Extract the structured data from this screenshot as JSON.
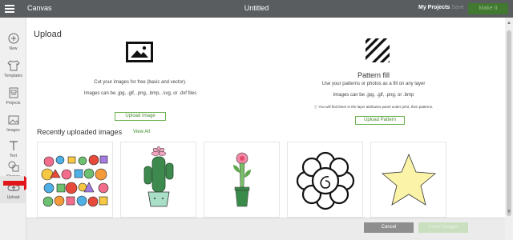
{
  "topbar": {
    "app_name": "Canvas",
    "document_title": "Untitled",
    "my_projects": "My Projects",
    "save": "Save",
    "make_it": "Make It"
  },
  "sidebar": {
    "items": [
      {
        "label": "New",
        "icon": "plus-icon"
      },
      {
        "label": "Templates",
        "icon": "shirt-icon"
      },
      {
        "label": "Projects",
        "icon": "projects-icon"
      },
      {
        "label": "Images",
        "icon": "image-icon"
      },
      {
        "label": "Text",
        "icon": "text-icon"
      },
      {
        "label": "Shapes",
        "icon": "shapes-icon"
      },
      {
        "label": "Upload",
        "icon": "upload-icon"
      }
    ]
  },
  "upload": {
    "title": "Upload",
    "description_1": "Cut your images for free (basic and vector).",
    "description_2": "Images can be .jpg, .gif, .png, .bmp, .svg, or .dxf files",
    "button": "Upload Image"
  },
  "pattern": {
    "title": "Pattern fill",
    "description_1": "Use your patterns or photos as a fill on any layer",
    "description_2": "Images can be .jpg, .gif, .png, or .bmp",
    "info": "You will find them in the layer attributes panel under print, then patterns.",
    "button": "Upload Pattern"
  },
  "recent": {
    "title": "Recently uploaded images",
    "view_all": "View All",
    "images": [
      {
        "icon": "doodle-collage-image"
      },
      {
        "icon": "cactus-image"
      },
      {
        "icon": "flower-pot-image"
      },
      {
        "icon": "mandala-image"
      },
      {
        "icon": "star-image"
      }
    ]
  },
  "footer": {
    "cancel": "Cancel",
    "insert": "Insert Images"
  },
  "colors": {
    "topbar": "#5a5d60",
    "accent_green": "#6db34f",
    "make_it": "#40792f",
    "arrow_red": "#e0161b"
  }
}
